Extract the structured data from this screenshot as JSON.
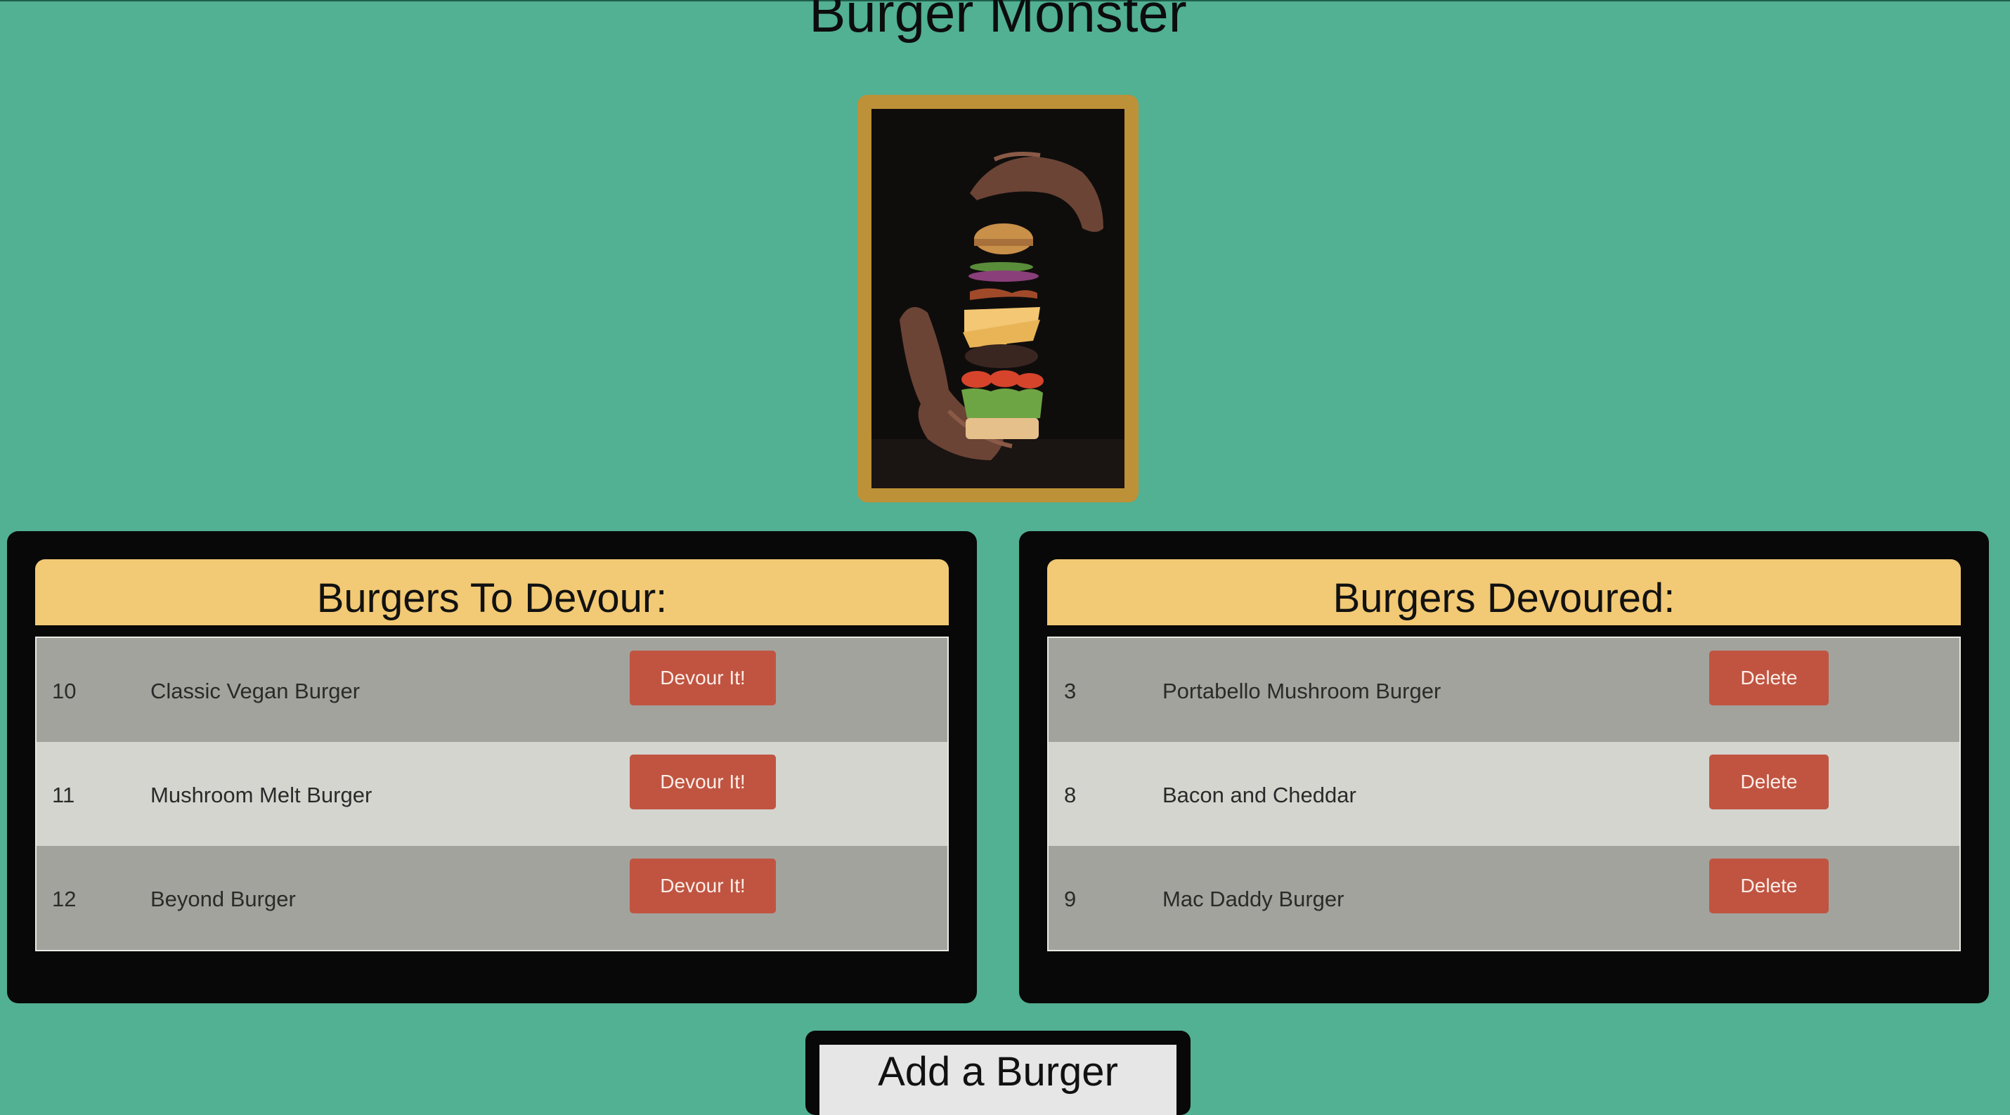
{
  "page": {
    "title": "Burger Monster",
    "hero_image": "floating burger layers between two hands on a black background"
  },
  "to_devour": {
    "heading": "Burgers To Devour:",
    "button_label": "Devour It!",
    "items": [
      {
        "id": "10",
        "name": "Classic Vegan Burger"
      },
      {
        "id": "11",
        "name": "Mushroom Melt Burger"
      },
      {
        "id": "12",
        "name": "Beyond Burger"
      }
    ]
  },
  "devoured": {
    "heading": "Burgers Devoured:",
    "button_label": "Delete",
    "items": [
      {
        "id": "3",
        "name": "Portabello Mushroom Burger"
      },
      {
        "id": "8",
        "name": "Bacon and Cheddar"
      },
      {
        "id": "9",
        "name": "Mac Daddy Burger"
      }
    ]
  },
  "add_form": {
    "heading": "Add a Burger"
  },
  "colors": {
    "background": "#52b093",
    "panel": "#080808",
    "panel_header": "#f2c974",
    "row_dark": "#a3a39d",
    "row_light": "#d4d5cf",
    "button": "#c05441",
    "image_frame": "#bd9137"
  }
}
